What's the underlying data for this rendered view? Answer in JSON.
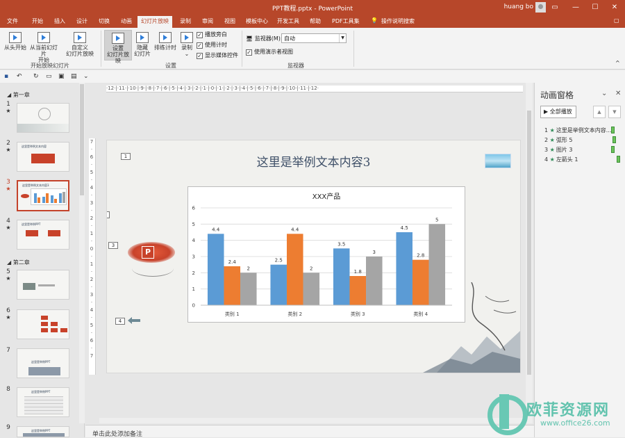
{
  "window": {
    "title": "PPT教程.pptx  -  PowerPoint",
    "user": "huang bo",
    "controls": {
      "restore": "▭",
      "minimize": "—",
      "maximize": "☐",
      "close": "✕"
    }
  },
  "menu": {
    "tabs": [
      "文件",
      "开始",
      "插入",
      "设计",
      "切换",
      "动画",
      "幻灯片放映",
      "录制",
      "审阅",
      "视图",
      "模板中心",
      "开发工具",
      "帮助",
      "PDF工具集"
    ],
    "active_tab": "幻灯片放映",
    "tell_me": "操作说明搜索",
    "share_icon": "comment-icon"
  },
  "ribbon": {
    "start_group": {
      "from_beginning": "从头开始",
      "from_current_1": "从当前幻灯片",
      "from_current_2": "开始",
      "custom_1": "自定义",
      "custom_2": "幻灯片放映",
      "label": "开始放映幻灯片"
    },
    "setup_group": {
      "setup_1": "设置",
      "setup_2": "幻灯片放映",
      "hide_1": "隐藏",
      "hide_2": "幻灯片",
      "rehearse": "排练计时",
      "record": "录制",
      "record_arrow": "⌄",
      "checks": [
        "播放旁白",
        "使用计时",
        "显示媒体控件"
      ],
      "label": "设置"
    },
    "monitor_group": {
      "monitor_label": "监视器(M):",
      "monitor_value": "自动",
      "presenter_view": "使用演示者视图",
      "label": "监视器"
    },
    "collapse_icon": "^"
  },
  "thumbnails": {
    "sections": [
      "第一章",
      "第二章"
    ],
    "slides": [
      {
        "num": "1",
        "star": "★"
      },
      {
        "num": "2",
        "star": "★",
        "title": "这里是举例文本内容"
      },
      {
        "num": "3",
        "star": "★",
        "title": "这里是举例文本内容3"
      },
      {
        "num": "4",
        "star": "★",
        "title": "这里是举例PPT"
      },
      {
        "num": "5",
        "star": "★"
      },
      {
        "num": "6",
        "star": "★"
      },
      {
        "num": "7",
        "star": "",
        "title": "这里是举例PPT"
      },
      {
        "num": "8",
        "star": "",
        "title": "这里是举例PPT"
      },
      {
        "num": "9",
        "star": "",
        "title": "这里是举例PPT"
      }
    ]
  },
  "slide": {
    "title": "这里是举例文本内容3",
    "anim_tags": [
      "1",
      "2",
      "3",
      "4"
    ]
  },
  "chart_data": {
    "type": "bar",
    "title": "XXX产品",
    "categories": [
      "类别 1",
      "类别 2",
      "类别 3",
      "类别 4"
    ],
    "series": [
      {
        "values": [
          4.4,
          2.5,
          3.5,
          4.5
        ],
        "color": "#5b9bd5"
      },
      {
        "values": [
          2.4,
          4.4,
          1.8,
          2.8
        ],
        "color": "#ed7d31"
      },
      {
        "values": [
          2,
          2,
          3,
          5
        ],
        "color": "#a5a5a5"
      }
    ],
    "ylim": [
      0,
      6
    ],
    "yticks": [
      0,
      1,
      2,
      3,
      4,
      5,
      6
    ],
    "grid": true
  },
  "rulers": {
    "horizontal": "·12·|·11·|·10·|·9·|·8·|·7·|·6·|·5·|·4·|·3·|·2·|·1·|·0·|·1·|·2·|·3·|·4·|·5·|·6·|·7·|·8·|·9·|·10·|·11·|·12·",
    "vertical": "7 · 6 · 5 · 4 · 3 · 2 · 1 · 0 · 1 · 2 · 3 · 4 · 5 · 6 · 7"
  },
  "notes": {
    "placeholder": "单击此处添加备注"
  },
  "animation_pane": {
    "title": "动画窗格",
    "play_all": "全部播放",
    "items": [
      {
        "num": "1",
        "label": "这里是举例文本内容..."
      },
      {
        "num": "2",
        "label": "弧形 5"
      },
      {
        "num": "3",
        "label": "图片 3"
      },
      {
        "num": "4",
        "label": "左箭头 1"
      }
    ]
  },
  "watermark": {
    "text_cn": "欧菲资源网",
    "text_url": "www.office26.com"
  },
  "colors": {
    "accent": "#b7472a",
    "ribbon_bg": "#f3f3f3",
    "panel_bg": "#e6e6e6"
  }
}
